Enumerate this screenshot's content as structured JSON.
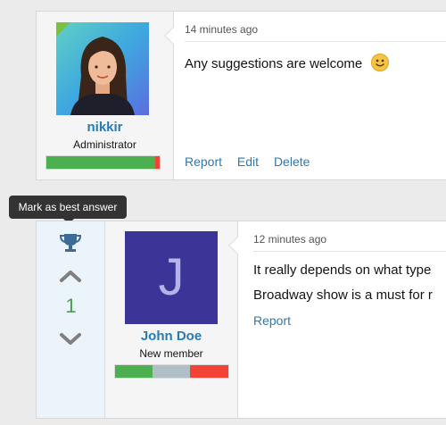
{
  "post1": {
    "user": {
      "name": "nikkir",
      "role": "Administrator"
    },
    "timestamp": "14 minutes ago",
    "message": "Any suggestions are welcome",
    "actions": {
      "report": "Report",
      "edit": "Edit",
      "delete": "Delete"
    },
    "reputation": [
      {
        "color": "#4caf50",
        "fraction": 0.96
      },
      {
        "color": "#f44336",
        "fraction": 0.04
      }
    ]
  },
  "tooltip": {
    "text": "Mark as best answer"
  },
  "post2": {
    "votes": "1",
    "user": {
      "name": "John Doe",
      "role": "New member",
      "initial": "J"
    },
    "timestamp": "12 minutes ago",
    "message_lines": [
      "It really depends on what type",
      "Broadway show is a must for r"
    ],
    "actions": {
      "report": "Report"
    },
    "reputation": [
      {
        "color": "#4caf50",
        "fraction": 0.33
      },
      {
        "color": "#b0bec5",
        "fraction": 0.33
      },
      {
        "color": "#f44336",
        "fraction": 0.34
      }
    ]
  }
}
